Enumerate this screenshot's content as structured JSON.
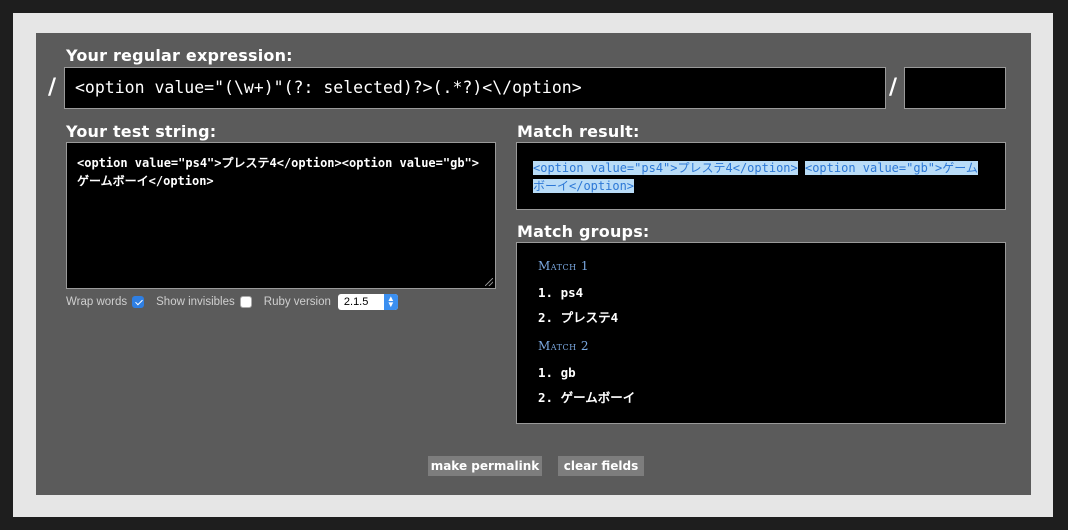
{
  "regex": {
    "label": "Your regular expression:",
    "open_delim": "/",
    "close_delim": "/",
    "pattern": "<option value=\"(\\w+)\"(?: selected)?>(.*?)<\\/option>",
    "flags": ""
  },
  "test": {
    "label": "Your test string:",
    "value": "<option value=\"ps4\">プレステ4</option><option value=\"gb\">ゲームボーイ</option>"
  },
  "options": {
    "wrap_words_label": "Wrap words",
    "wrap_words_checked": true,
    "show_invisibles_label": "Show invisibles",
    "show_invisibles_checked": false,
    "ruby_version_label": "Ruby version",
    "ruby_version_value": "2.1.5"
  },
  "result": {
    "label": "Match result:",
    "part1": "<option value=\"ps4\">プレステ4</option>",
    "part2": "<option value=\"gb\">ゲームボーイ</option>"
  },
  "groups": {
    "label": "Match groups:",
    "matches": [
      {
        "title": "Match 1",
        "items": [
          "1.  ps4",
          "2.  プレステ4"
        ]
      },
      {
        "title": "Match 2",
        "items": [
          "1.  gb",
          "2.  ゲームボーイ"
        ]
      }
    ]
  },
  "buttons": {
    "permalink": "make permalink",
    "clear": "clear fields"
  },
  "colors": {
    "panel_bg": "#5b5b5b",
    "box_bg": "#000000",
    "highlight_bg": "#b9dcf7",
    "highlight_text": "#2d78d6",
    "match_heading": "#7aa8e0"
  }
}
